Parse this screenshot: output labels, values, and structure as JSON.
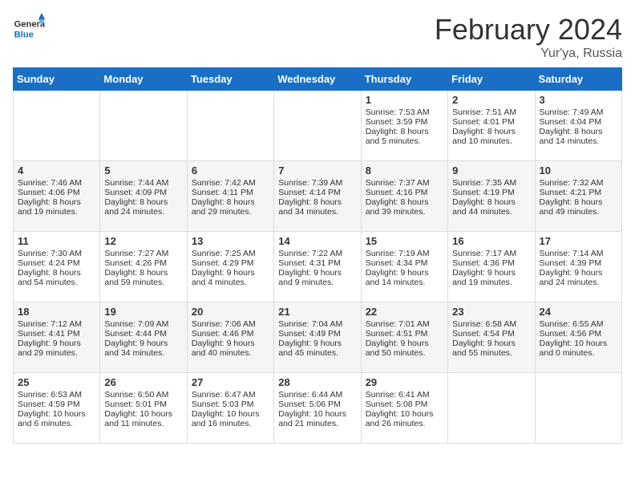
{
  "header": {
    "logo_general": "General",
    "logo_blue": "Blue",
    "month_year": "February 2024",
    "location": "Yur'ya, Russia"
  },
  "weekdays": [
    "Sunday",
    "Monday",
    "Tuesday",
    "Wednesday",
    "Thursday",
    "Friday",
    "Saturday"
  ],
  "weeks": [
    [
      {
        "day": "",
        "sunrise": "",
        "sunset": "",
        "daylight": ""
      },
      {
        "day": "",
        "sunrise": "",
        "sunset": "",
        "daylight": ""
      },
      {
        "day": "",
        "sunrise": "",
        "sunset": "",
        "daylight": ""
      },
      {
        "day": "",
        "sunrise": "",
        "sunset": "",
        "daylight": ""
      },
      {
        "day": "1",
        "sunrise": "Sunrise: 7:53 AM",
        "sunset": "Sunset: 3:59 PM",
        "daylight": "Daylight: 8 hours and 5 minutes."
      },
      {
        "day": "2",
        "sunrise": "Sunrise: 7:51 AM",
        "sunset": "Sunset: 4:01 PM",
        "daylight": "Daylight: 8 hours and 10 minutes."
      },
      {
        "day": "3",
        "sunrise": "Sunrise: 7:49 AM",
        "sunset": "Sunset: 4:04 PM",
        "daylight": "Daylight: 8 hours and 14 minutes."
      }
    ],
    [
      {
        "day": "4",
        "sunrise": "Sunrise: 7:46 AM",
        "sunset": "Sunset: 4:06 PM",
        "daylight": "Daylight: 8 hours and 19 minutes."
      },
      {
        "day": "5",
        "sunrise": "Sunrise: 7:44 AM",
        "sunset": "Sunset: 4:09 PM",
        "daylight": "Daylight: 8 hours and 24 minutes."
      },
      {
        "day": "6",
        "sunrise": "Sunrise: 7:42 AM",
        "sunset": "Sunset: 4:11 PM",
        "daylight": "Daylight: 8 hours and 29 minutes."
      },
      {
        "day": "7",
        "sunrise": "Sunrise: 7:39 AM",
        "sunset": "Sunset: 4:14 PM",
        "daylight": "Daylight: 8 hours and 34 minutes."
      },
      {
        "day": "8",
        "sunrise": "Sunrise: 7:37 AM",
        "sunset": "Sunset: 4:16 PM",
        "daylight": "Daylight: 8 hours and 39 minutes."
      },
      {
        "day": "9",
        "sunrise": "Sunrise: 7:35 AM",
        "sunset": "Sunset: 4:19 PM",
        "daylight": "Daylight: 8 hours and 44 minutes."
      },
      {
        "day": "10",
        "sunrise": "Sunrise: 7:32 AM",
        "sunset": "Sunset: 4:21 PM",
        "daylight": "Daylight: 8 hours and 49 minutes."
      }
    ],
    [
      {
        "day": "11",
        "sunrise": "Sunrise: 7:30 AM",
        "sunset": "Sunset: 4:24 PM",
        "daylight": "Daylight: 8 hours and 54 minutes."
      },
      {
        "day": "12",
        "sunrise": "Sunrise: 7:27 AM",
        "sunset": "Sunset: 4:26 PM",
        "daylight": "Daylight: 8 hours and 59 minutes."
      },
      {
        "day": "13",
        "sunrise": "Sunrise: 7:25 AM",
        "sunset": "Sunset: 4:29 PM",
        "daylight": "Daylight: 9 hours and 4 minutes."
      },
      {
        "day": "14",
        "sunrise": "Sunrise: 7:22 AM",
        "sunset": "Sunset: 4:31 PM",
        "daylight": "Daylight: 9 hours and 9 minutes."
      },
      {
        "day": "15",
        "sunrise": "Sunrise: 7:19 AM",
        "sunset": "Sunset: 4:34 PM",
        "daylight": "Daylight: 9 hours and 14 minutes."
      },
      {
        "day": "16",
        "sunrise": "Sunrise: 7:17 AM",
        "sunset": "Sunset: 4:36 PM",
        "daylight": "Daylight: 9 hours and 19 minutes."
      },
      {
        "day": "17",
        "sunrise": "Sunrise: 7:14 AM",
        "sunset": "Sunset: 4:39 PM",
        "daylight": "Daylight: 9 hours and 24 minutes."
      }
    ],
    [
      {
        "day": "18",
        "sunrise": "Sunrise: 7:12 AM",
        "sunset": "Sunset: 4:41 PM",
        "daylight": "Daylight: 9 hours and 29 minutes."
      },
      {
        "day": "19",
        "sunrise": "Sunrise: 7:09 AM",
        "sunset": "Sunset: 4:44 PM",
        "daylight": "Daylight: 9 hours and 34 minutes."
      },
      {
        "day": "20",
        "sunrise": "Sunrise: 7:06 AM",
        "sunset": "Sunset: 4:46 PM",
        "daylight": "Daylight: 9 hours and 40 minutes."
      },
      {
        "day": "21",
        "sunrise": "Sunrise: 7:04 AM",
        "sunset": "Sunset: 4:49 PM",
        "daylight": "Daylight: 9 hours and 45 minutes."
      },
      {
        "day": "22",
        "sunrise": "Sunrise: 7:01 AM",
        "sunset": "Sunset: 4:51 PM",
        "daylight": "Daylight: 9 hours and 50 minutes."
      },
      {
        "day": "23",
        "sunrise": "Sunrise: 6:58 AM",
        "sunset": "Sunset: 4:54 PM",
        "daylight": "Daylight: 9 hours and 55 minutes."
      },
      {
        "day": "24",
        "sunrise": "Sunrise: 6:55 AM",
        "sunset": "Sunset: 4:56 PM",
        "daylight": "Daylight: 10 hours and 0 minutes."
      }
    ],
    [
      {
        "day": "25",
        "sunrise": "Sunrise: 6:53 AM",
        "sunset": "Sunset: 4:59 PM",
        "daylight": "Daylight: 10 hours and 6 minutes."
      },
      {
        "day": "26",
        "sunrise": "Sunrise: 6:50 AM",
        "sunset": "Sunset: 5:01 PM",
        "daylight": "Daylight: 10 hours and 11 minutes."
      },
      {
        "day": "27",
        "sunrise": "Sunrise: 6:47 AM",
        "sunset": "Sunset: 5:03 PM",
        "daylight": "Daylight: 10 hours and 16 minutes."
      },
      {
        "day": "28",
        "sunrise": "Sunrise: 6:44 AM",
        "sunset": "Sunset: 5:06 PM",
        "daylight": "Daylight: 10 hours and 21 minutes."
      },
      {
        "day": "29",
        "sunrise": "Sunrise: 6:41 AM",
        "sunset": "Sunset: 5:08 PM",
        "daylight": "Daylight: 10 hours and 26 minutes."
      },
      {
        "day": "",
        "sunrise": "",
        "sunset": "",
        "daylight": ""
      },
      {
        "day": "",
        "sunrise": "",
        "sunset": "",
        "daylight": ""
      }
    ]
  ]
}
